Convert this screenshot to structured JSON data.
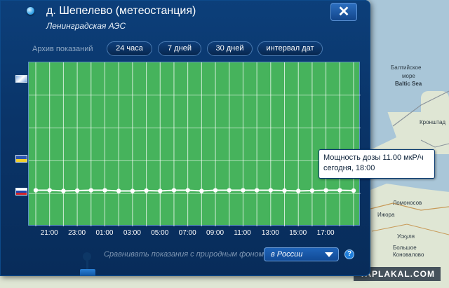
{
  "map": {
    "labels": [
      "Балтийское",
      "море",
      "Baltic Sea",
      "Кронштад",
      "Ломоносов",
      "Ижора",
      "Ускуля",
      "Большое",
      "Коновалово"
    ],
    "watermark": "YAPLAKAL.COM"
  },
  "window": {
    "title": "д. Шепелево (метеостанция)",
    "subtitle": "Ленинградская АЭС",
    "close_label": "✕"
  },
  "archive": {
    "label": "Архив показаний",
    "buttons": [
      "24 часа",
      "7 дней",
      "30 дней",
      "интервал дат"
    ]
  },
  "chart_data": {
    "type": "line",
    "x": [
      "20:00",
      "21:00",
      "22:00",
      "23:00",
      "00:00",
      "01:00",
      "02:00",
      "03:00",
      "04:00",
      "05:00",
      "06:00",
      "07:00",
      "08:00",
      "09:00",
      "10:00",
      "11:00",
      "12:00",
      "13:00",
      "14:00",
      "15:00",
      "16:00",
      "17:00",
      "18:00",
      "19:00"
    ],
    "xtick_labels": [
      "21:00",
      "23:00",
      "01:00",
      "03:00",
      "05:00",
      "07:00",
      "09:00",
      "11:00",
      "13:00",
      "15:00",
      "17:00"
    ],
    "series": [
      {
        "values": [
          11.0,
          11.0,
          10.8,
          10.9,
          11.0,
          11.0,
          10.8,
          10.8,
          10.9,
          10.8,
          11.0,
          11.0,
          10.8,
          11.0,
          11.0,
          11.0,
          11.0,
          11.0,
          10.9,
          10.8,
          10.9,
          11.0,
          11.0,
          10.9
        ]
      }
    ],
    "ylim": [
      0,
      50
    ],
    "grid": true,
    "colors": {
      "background": "#46b35c",
      "grid": "#ffffff",
      "line": "#ffffff"
    }
  },
  "flags": [
    "flag-icon-top",
    "flag-icon-middle",
    "flag-icon-russia"
  ],
  "tooltip": {
    "line1": "Мощность дозы 11.00 мкР/ч",
    "line2": "сегодня, 18:00"
  },
  "compare": {
    "label": "Сравнивать показания с природным фоном",
    "selected": "в России",
    "help": "?"
  }
}
